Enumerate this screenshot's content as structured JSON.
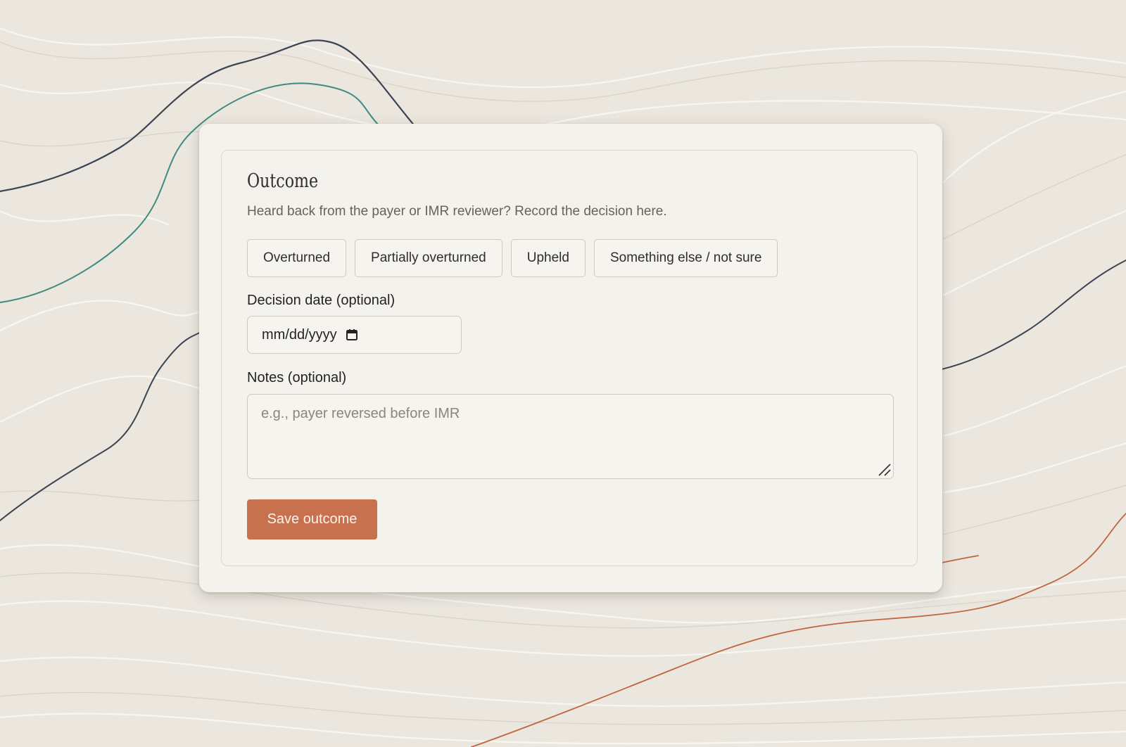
{
  "outcome": {
    "title": "Outcome",
    "subtitle": "Heard back from the payer or IMR reviewer? Record the decision here.",
    "options": [
      {
        "label": "Overturned"
      },
      {
        "label": "Partially overturned"
      },
      {
        "label": "Upheld"
      },
      {
        "label": "Something else / not sure"
      }
    ],
    "decision_date": {
      "label": "Decision date (optional)",
      "value": "mm/dd/yyyy",
      "icon": "calendar-icon"
    },
    "notes": {
      "label": "Notes (optional)",
      "placeholder": "e.g., payer reversed before IMR",
      "value": ""
    },
    "save_label": "Save outcome"
  },
  "colors": {
    "background": "#ebe7df",
    "card": "#f4f2ec",
    "accent": "#c8714f",
    "line_navy": "#394552",
    "line_teal": "#3f8b82",
    "line_copper": "#c2643d"
  }
}
